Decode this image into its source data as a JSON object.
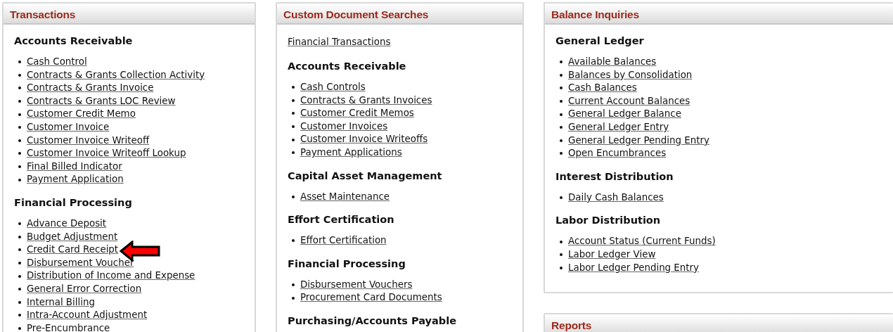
{
  "columns": [
    {
      "panels": [
        {
          "title": "Transactions",
          "blocks": [
            {
              "kind": "section",
              "heading": "Accounts Receivable",
              "links": [
                {
                  "text": "Cash Control"
                },
                {
                  "text": "Contracts & Grants Collection Activity"
                },
                {
                  "text": "Contracts & Grants Invoice"
                },
                {
                  "text": "Contracts & Grants LOC Review"
                },
                {
                  "text": "Customer Credit Memo"
                },
                {
                  "text": "Customer Invoice"
                },
                {
                  "text": "Customer Invoice Writeoff"
                },
                {
                  "text": "Customer Invoice Writeoff Lookup"
                },
                {
                  "text": "Final Billed Indicator"
                },
                {
                  "text": "Payment Application"
                }
              ]
            },
            {
              "kind": "section",
              "heading": "Financial Processing",
              "links": [
                {
                  "text": "Advance Deposit",
                  "pointed": false
                },
                {
                  "text": "Budget Adjustment",
                  "pointed": false
                },
                {
                  "text": "Credit Card Receipt",
                  "pointed": true
                },
                {
                  "text": "Disbursement Voucher",
                  "pointed": false
                },
                {
                  "text": "Distribution of Income and Expense",
                  "pointed": false
                },
                {
                  "text": "General Error Correction",
                  "pointed": false
                },
                {
                  "text": "Internal Billing",
                  "pointed": false
                },
                {
                  "text": "Intra-Account Adjustment",
                  "pointed": false
                },
                {
                  "text": "Pre-Encumbrance",
                  "pointed": false
                }
              ]
            }
          ]
        }
      ]
    },
    {
      "panels": [
        {
          "title": "Custom Document Searches",
          "blocks": [
            {
              "kind": "link",
              "text": "Financial Transactions"
            },
            {
              "kind": "section",
              "heading": "Accounts Receivable",
              "links": [
                {
                  "text": "Cash Controls"
                },
                {
                  "text": "Contracts & Grants Invoices"
                },
                {
                  "text": "Customer Credit Memos"
                },
                {
                  "text": "Customer Invoices"
                },
                {
                  "text": "Customer Invoice Writeoffs"
                },
                {
                  "text": "Payment Applications"
                }
              ]
            },
            {
              "kind": "section",
              "heading": "Capital Asset Management",
              "links": [
                {
                  "text": "Asset Maintenance"
                }
              ]
            },
            {
              "kind": "section",
              "heading": "Effort Certification",
              "links": [
                {
                  "text": "Effort Certification"
                }
              ]
            },
            {
              "kind": "section",
              "heading": "Financial Processing",
              "links": [
                {
                  "text": "Disbursement Vouchers"
                },
                {
                  "text": "Procurement Card Documents"
                }
              ]
            },
            {
              "kind": "section",
              "heading": "Purchasing/Accounts Payable"
            }
          ]
        }
      ]
    },
    {
      "panels": [
        {
          "title": "Balance Inquiries",
          "blocks": [
            {
              "kind": "section",
              "heading": "General Ledger",
              "links": [
                {
                  "text": "Available Balances"
                },
                {
                  "text": "Balances by Consolidation"
                },
                {
                  "text": "Cash Balances"
                },
                {
                  "text": "Current Account Balances"
                },
                {
                  "text": "General Ledger Balance"
                },
                {
                  "text": "General Ledger Entry"
                },
                {
                  "text": "General Ledger Pending Entry"
                },
                {
                  "text": "Open Encumbrances"
                }
              ]
            },
            {
              "kind": "section",
              "heading": "Interest Distribution",
              "links": [
                {
                  "text": "Daily Cash Balances"
                }
              ]
            },
            {
              "kind": "section",
              "heading": "Labor Distribution",
              "links": [
                {
                  "text": "Account Status (Current Funds)"
                },
                {
                  "text": "Labor Ledger View"
                },
                {
                  "text": "Labor Ledger Pending Entry"
                }
              ]
            }
          ]
        },
        {
          "title": "Reports"
        }
      ]
    }
  ]
}
